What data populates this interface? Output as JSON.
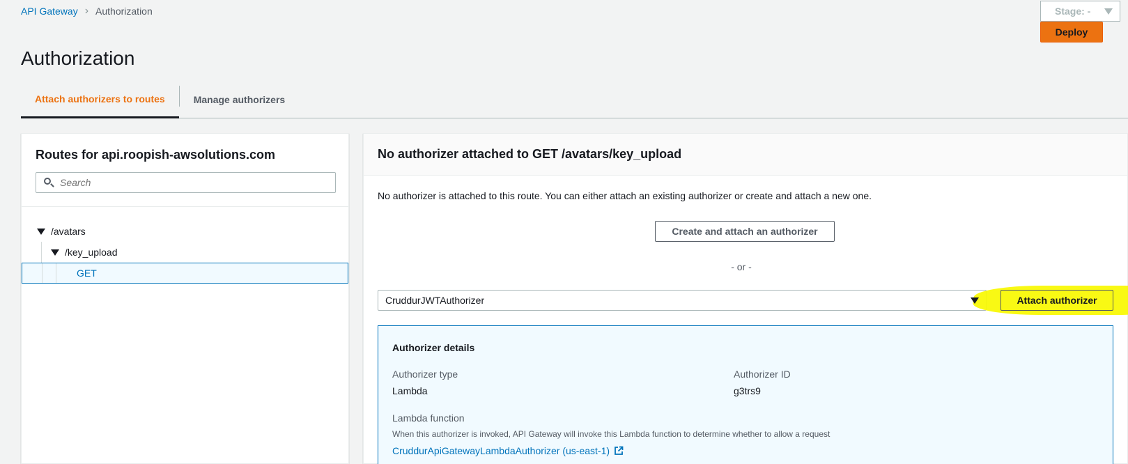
{
  "breadcrumb": {
    "root": "API Gateway",
    "current": "Authorization"
  },
  "stage": {
    "label": "Stage: -"
  },
  "deploy": {
    "label": "Deploy"
  },
  "page": {
    "title": "Authorization"
  },
  "tabs": [
    {
      "label": "Attach authorizers to routes",
      "active": true
    },
    {
      "label": "Manage authorizers",
      "active": false
    }
  ],
  "routes": {
    "title": "Routes for api.roopish-awsolutions.com",
    "search_placeholder": "Search",
    "tree": [
      {
        "label": "/avatars"
      },
      {
        "label": "/key_upload"
      },
      {
        "label": "GET"
      }
    ]
  },
  "detail": {
    "title": "No authorizer attached to GET /avatars/key_upload",
    "description": "No authorizer is attached to this route. You can either attach an existing authorizer or create and attach a new one.",
    "create_button": "Create and attach an authorizer",
    "or_text": "- or -",
    "selected_authorizer": "CruddurJWTAuthorizer",
    "attach_button": "Attach authorizer",
    "highlight_color": "#f9f900"
  },
  "authorizer_details": {
    "title": "Authorizer details",
    "type_label": "Authorizer type",
    "type_value": "Lambda",
    "id_label": "Authorizer ID",
    "id_value": "g3trs9",
    "function_label": "Lambda function",
    "function_hint": "When this authorizer is invoked, API Gateway will invoke this Lambda function to determine whether to allow a request",
    "function_link": "CruddurApiGatewayLambdaAuthorizer (us-east-1)"
  },
  "colors": {
    "accent": "#ec7211",
    "link": "#0073bb"
  }
}
